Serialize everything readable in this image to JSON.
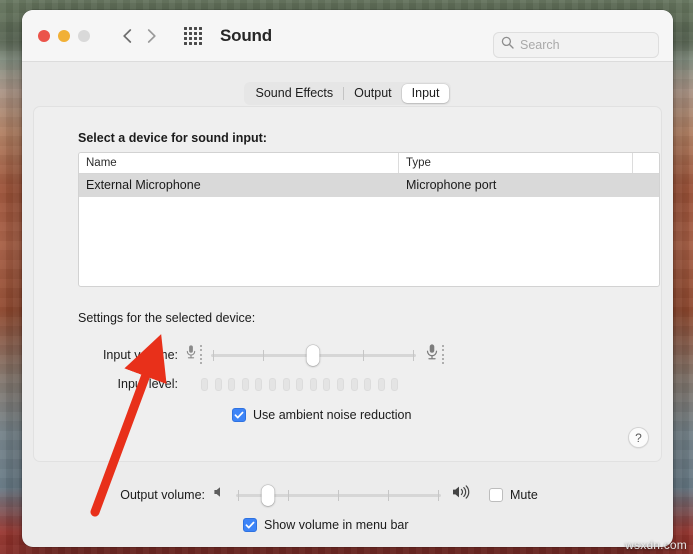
{
  "window": {
    "title": "Sound",
    "traffic_lights": [
      "close",
      "minimize",
      "maximize"
    ],
    "nav_back": "back-chevron",
    "nav_forward": "forward-chevron",
    "grid_button": "all-preferences-grid"
  },
  "search": {
    "placeholder": "Search",
    "value": ""
  },
  "tabs": [
    {
      "label": "Sound Effects",
      "selected": false
    },
    {
      "label": "Output",
      "selected": false
    },
    {
      "label": "Input",
      "selected": true
    }
  ],
  "device_section": {
    "label": "Select a device for sound input:",
    "columns": [
      "Name",
      "Type"
    ],
    "rows": [
      {
        "name": "External Microphone",
        "type": "Microphone port",
        "selected": true
      }
    ]
  },
  "settings_section": {
    "label": "Settings for the selected device:",
    "input_volume": {
      "label": "Input volume:",
      "value_percent": 50,
      "left_icon": "microphone-small-icon",
      "right_icon": "microphone-large-icon"
    },
    "input_level": {
      "label": "Input level:",
      "segments": 15,
      "active": 0
    },
    "ambient_noise": {
      "label": "Use ambient noise reduction",
      "checked": true
    },
    "help_button": "?"
  },
  "output_section": {
    "output_volume": {
      "label": "Output volume:",
      "value_percent": 15,
      "left_icon": "speaker-mute-icon",
      "right_icon": "speaker-loud-icon"
    },
    "mute": {
      "label": "Mute",
      "checked": false
    },
    "show_in_menu_bar": {
      "label": "Show volume in menu bar",
      "checked": true
    }
  },
  "annotation": {
    "type": "red-arrow",
    "color": "#e8301a",
    "points_to": "Input volume:"
  },
  "watermark": {
    "text": "wsxdn.com"
  }
}
